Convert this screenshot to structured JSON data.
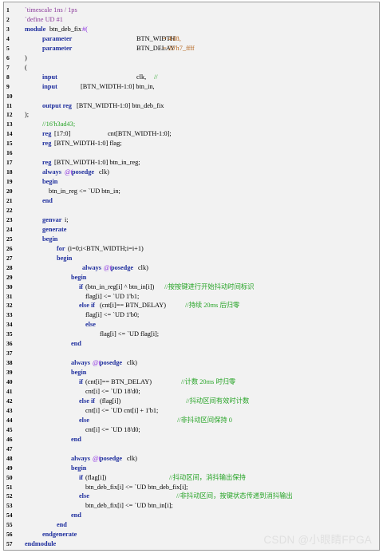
{
  "watermark": "CSDN @小眼睛FPGA",
  "lines": [
    {
      "n": "1",
      "segs": [
        [
          0,
          "`timescale 1ns / 1ps",
          "dr"
        ]
      ]
    },
    {
      "n": "2",
      "segs": [
        [
          0,
          "`define UD #1",
          "dr"
        ]
      ]
    },
    {
      "n": "3",
      "segs": [
        [
          0,
          "module",
          "kw"
        ],
        [
          31,
          "btn_deb_fix",
          "t"
        ],
        [
          72,
          "#(",
          "pu"
        ]
      ]
    },
    {
      "n": "4",
      "segs": [
        [
          22,
          "parameter",
          "kw"
        ],
        [
          140,
          "BTN_WIDTH",
          "t"
        ],
        [
          173,
          "= 4'd8,",
          "nm"
        ]
      ]
    },
    {
      "n": "5",
      "segs": [
        [
          22,
          "parameter",
          "kw"
        ],
        [
          140,
          "BTN_DELAY",
          "t"
        ],
        [
          173,
          "= 20'h7_ffff",
          "nm"
        ]
      ]
    },
    {
      "n": "6",
      "segs": [
        [
          0,
          ")",
          "t"
        ]
      ]
    },
    {
      "n": "7",
      "segs": [
        [
          0,
          "(",
          "t"
        ]
      ]
    },
    {
      "n": "8",
      "segs": [
        [
          22,
          "input",
          "kw"
        ],
        [
          140,
          "clk,",
          "t"
        ],
        [
          162,
          "//",
          "cm"
        ]
      ]
    },
    {
      "n": "9",
      "segs": [
        [
          22,
          "input",
          "kw"
        ],
        [
          70,
          "[BTN_WIDTH-1:0] btn_in,",
          "t"
        ]
      ]
    },
    {
      "n": "10",
      "segs": []
    },
    {
      "n": "11",
      "segs": [
        [
          22,
          "output reg",
          "kw"
        ],
        [
          65,
          "[BTN_WIDTH-1:0] btn_deb_fix",
          "t"
        ]
      ]
    },
    {
      "n": "12",
      "segs": [
        [
          0,
          ");",
          "t"
        ]
      ]
    },
    {
      "n": "13",
      "segs": [
        [
          22,
          "//16'h3ad43;",
          "cm"
        ]
      ]
    },
    {
      "n": "14",
      "segs": [
        [
          22,
          "reg",
          "kw"
        ],
        [
          37,
          "[17:0]",
          "t"
        ],
        [
          104,
          "cnt[BTN_WIDTH-1:0];",
          "t"
        ]
      ]
    },
    {
      "n": "15",
      "segs": [
        [
          22,
          "reg",
          "kw"
        ],
        [
          37,
          "[BTN_WIDTH-1:0] flag;",
          "t"
        ]
      ]
    },
    {
      "n": "16",
      "segs": []
    },
    {
      "n": "17",
      "segs": [
        [
          22,
          "reg",
          "kw"
        ],
        [
          37,
          "[BTN_WIDTH-1:0] btn_in_reg;",
          "t"
        ]
      ]
    },
    {
      "n": "18",
      "segs": [
        [
          22,
          "always",
          "kw"
        ],
        [
          50,
          "@(",
          "pu"
        ],
        [
          59,
          "posedge",
          "kw"
        ],
        [
          93,
          "clk)",
          "t"
        ]
      ]
    },
    {
      "n": "19",
      "segs": [
        [
          22,
          "begin",
          "kw"
        ]
      ]
    },
    {
      "n": "20",
      "segs": [
        [
          30,
          "btn_in_reg <= `UD btn_in;",
          "t"
        ]
      ]
    },
    {
      "n": "21",
      "segs": [
        [
          22,
          "end",
          "kw"
        ]
      ]
    },
    {
      "n": "22",
      "segs": []
    },
    {
      "n": "23",
      "segs": [
        [
          22,
          "genvar",
          "kw"
        ],
        [
          50,
          "i;",
          "t"
        ]
      ]
    },
    {
      "n": "24",
      "segs": [
        [
          22,
          "generate",
          "kw"
        ]
      ]
    },
    {
      "n": "25",
      "segs": [
        [
          22,
          "begin",
          "kw"
        ]
      ]
    },
    {
      "n": "26",
      "segs": [
        [
          40,
          "for",
          "kw"
        ],
        [
          54,
          "(i=0;i<BTN_WIDTH;i=i+1)",
          "t"
        ]
      ]
    },
    {
      "n": "27",
      "segs": [
        [
          40,
          "begin",
          "kw"
        ]
      ]
    },
    {
      "n": "28",
      "segs": [
        [
          72,
          "always",
          "kw"
        ],
        [
          99,
          "@(",
          "pu"
        ],
        [
          108,
          "posedge",
          "kw"
        ],
        [
          142,
          "clk)",
          "t"
        ]
      ]
    },
    {
      "n": "29",
      "segs": [
        [
          58,
          "begin",
          "kw"
        ]
      ]
    },
    {
      "n": "30",
      "segs": [
        [
          68,
          "if",
          "kw"
        ],
        [
          76,
          "(btn_in_reg[i] ^ btn_in[i])",
          "t"
        ],
        [
          175,
          "//按按键进行开始抖动时间标识",
          "cm"
        ]
      ]
    },
    {
      "n": "31",
      "segs": [
        [
          76,
          "flag[i] <= `UD 1'b1;",
          "t"
        ]
      ]
    },
    {
      "n": "32",
      "segs": [
        [
          68,
          "else if",
          "kw"
        ],
        [
          94,
          "(cnt[i]== BTN_DELAY)",
          "t"
        ],
        [
          201,
          "//持续 20ms 后归零",
          "cm"
        ]
      ]
    },
    {
      "n": "33",
      "segs": [
        [
          76,
          "flag[i] <= `UD 1'b0;",
          "t"
        ]
      ]
    },
    {
      "n": "34",
      "segs": [
        [
          76,
          "else",
          "kw"
        ]
      ]
    },
    {
      "n": "35",
      "segs": [
        [
          94,
          "flag[i] <= `UD flag[i];",
          "t"
        ]
      ]
    },
    {
      "n": "36",
      "segs": [
        [
          58,
          "end",
          "kw"
        ]
      ]
    },
    {
      "n": "37",
      "segs": []
    },
    {
      "n": "38",
      "segs": [
        [
          58,
          "always",
          "kw"
        ],
        [
          85,
          "@(",
          "pu"
        ],
        [
          94,
          "posedge",
          "kw"
        ],
        [
          128,
          "clk)",
          "t"
        ]
      ]
    },
    {
      "n": "39",
      "segs": [
        [
          58,
          "begin",
          "kw"
        ]
      ]
    },
    {
      "n": "40",
      "segs": [
        [
          68,
          "if",
          "kw"
        ],
        [
          76,
          "(cnt[i]== BTN_DELAY)",
          "t"
        ],
        [
          196,
          "//计数 20ms 时归零",
          "cm"
        ]
      ]
    },
    {
      "n": "41",
      "segs": [
        [
          76,
          "cnt[i] <= `UD 18'd0;",
          "t"
        ]
      ]
    },
    {
      "n": "42",
      "segs": [
        [
          68,
          "else if",
          "kw"
        ],
        [
          94,
          "(flag[i])",
          "t"
        ],
        [
          202,
          "//抖动区间有效时计数",
          "cm"
        ]
      ]
    },
    {
      "n": "43",
      "segs": [
        [
          76,
          "cnt[i] <= `UD cnt[i] + 1'b1;",
          "t"
        ]
      ]
    },
    {
      "n": "44",
      "segs": [
        [
          68,
          "else",
          "kw"
        ],
        [
          191,
          "//非抖动区间保持 0",
          "cm"
        ]
      ]
    },
    {
      "n": "45",
      "segs": [
        [
          76,
          "cnt[i] <= `UD 18'd0;",
          "t"
        ]
      ]
    },
    {
      "n": "46",
      "segs": [
        [
          58,
          "end",
          "kw"
        ]
      ]
    },
    {
      "n": "47",
      "segs": []
    },
    {
      "n": "48",
      "segs": [
        [
          58,
          "always",
          "kw"
        ],
        [
          85,
          "@(",
          "pu"
        ],
        [
          94,
          "posedge",
          "kw"
        ],
        [
          128,
          "clk)",
          "t"
        ]
      ]
    },
    {
      "n": "49",
      "segs": [
        [
          58,
          "begin",
          "kw"
        ]
      ]
    },
    {
      "n": "50",
      "segs": [
        [
          68,
          "if",
          "kw"
        ],
        [
          76,
          "(flag[i])",
          "t"
        ],
        [
          181,
          "//抖动区间，消抖输出保持",
          "cm"
        ]
      ]
    },
    {
      "n": "51",
      "segs": [
        [
          76,
          "btn_deb_fix[i] <= `UD btn_deb_fix[i];",
          "t"
        ]
      ]
    },
    {
      "n": "52",
      "segs": [
        [
          68,
          "else",
          "kw"
        ],
        [
          190,
          "//非抖动区间，按键状态传递到消抖输出",
          "cm"
        ]
      ]
    },
    {
      "n": "53",
      "segs": [
        [
          76,
          "btn_deb_fix[i] <= `UD btn_in[i];",
          "t"
        ]
      ]
    },
    {
      "n": "54",
      "segs": [
        [
          58,
          "end",
          "kw"
        ]
      ]
    },
    {
      "n": "55",
      "segs": [
        [
          40,
          "end",
          "kw"
        ]
      ]
    },
    {
      "n": "56",
      "segs": [
        [
          22,
          "endgenerate",
          "kw"
        ]
      ]
    },
    {
      "n": "57",
      "segs": [
        [
          0,
          "endmodule",
          "kw"
        ]
      ]
    }
  ]
}
